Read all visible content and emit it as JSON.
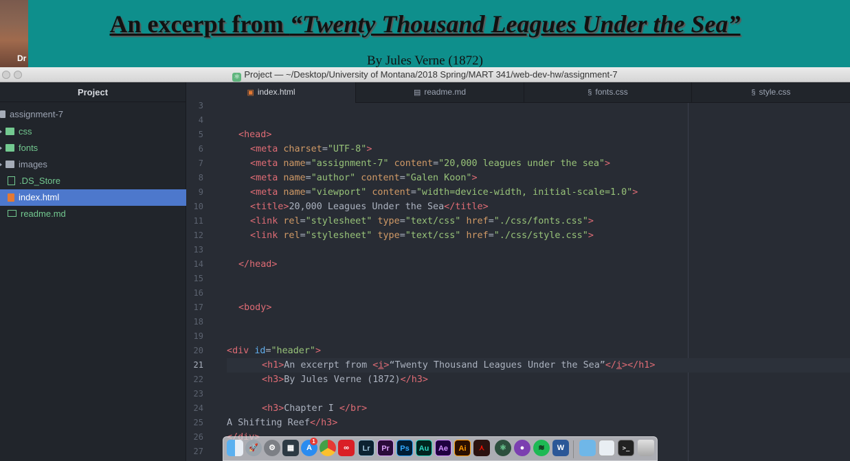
{
  "webpage": {
    "thumb_text": "Dr",
    "h1_prefix": "An excerpt from ",
    "h1_italic": "“Twenty Thousand Leagues Under the Sea”",
    "h3": "By Jules Verne (1872)"
  },
  "window": {
    "title": "Project — ~/Desktop/University of Montana/2018 Spring/MART 341/web-dev-hw/assignment-7"
  },
  "sidebar": {
    "header": "Project",
    "root": "assignment-7",
    "items": [
      {
        "label": "css",
        "type": "folder"
      },
      {
        "label": "fonts",
        "type": "folder"
      },
      {
        "label": "images",
        "type": "folder"
      },
      {
        "label": ".DS_Store",
        "type": "file"
      },
      {
        "label": "index.html",
        "type": "file"
      },
      {
        "label": "readme.md",
        "type": "file"
      }
    ]
  },
  "tabs": [
    {
      "label": "index.html",
      "icon": "html5-icon"
    },
    {
      "label": "readme.md",
      "icon": "book-icon"
    },
    {
      "label": "fonts.css",
      "icon": "css3-icon"
    },
    {
      "label": "style.css",
      "icon": "css3-icon"
    }
  ],
  "editor": {
    "line_numbers": [
      "3",
      "4",
      "5",
      "6",
      "7",
      "8",
      "9",
      "10",
      "11",
      "12",
      "13",
      "14",
      "15",
      "16",
      "17",
      "18",
      "19",
      "20",
      "21",
      "22",
      "23",
      "24",
      "25",
      "26",
      "27"
    ],
    "current_line": "21",
    "code": {
      "l5_open": "<",
      "l5_tag": "head",
      "l5_close": ">",
      "l6_tag": "meta",
      "l6_attr": "charset",
      "l6_val": "\"UTF-8\"",
      "l7_tag": "meta",
      "l7_attr1": "name",
      "l7_val1": "\"assignment-7\"",
      "l7_attr2": "content",
      "l7_val2": "\"20,000 leagues under the sea\"",
      "l8_tag": "meta",
      "l8_attr1": "name",
      "l8_val1": "\"author\"",
      "l8_attr2": "content",
      "l8_val2": "\"Galen Koon\"",
      "l9_tag": "meta",
      "l9_attr1": "name",
      "l9_val1": "\"viewport\"",
      "l9_attr2": "content",
      "l9_val2": "\"width=device-width, initial-scale=1.0\"",
      "l10_tag": "title",
      "l10_text": "20,000 Leagues Under the Sea",
      "l11_tag": "link",
      "l11_a1": "rel",
      "l11_v1": "\"stylesheet\"",
      "l11_a2": "type",
      "l11_v2": "\"text/css\"",
      "l11_a3": "href",
      "l11_v3": "\"./css/fonts.css\"",
      "l12_tag": "link",
      "l12_a1": "rel",
      "l12_v1": "\"stylesheet\"",
      "l12_a2": "type",
      "l12_v2": "\"text/css\"",
      "l12_a3": "href",
      "l12_v3": "\"./css/style.css\"",
      "l14_tag": "head",
      "l17_tag": "body",
      "l20_tag": "div",
      "l20_attr": "id",
      "l20_val": "\"header\"",
      "l21_tag": "h1",
      "l21_text1": "An excerpt from ",
      "l21_itag": "i",
      "l21_text2": "“Twenty Thousand Leagues Under the Sea”",
      "l22_tag": "h3",
      "l22_text": "By Jules Verne (1872)",
      "l24_tag": "h3",
      "l24_text": "Chapter I ",
      "l24_br": "br",
      "l25_text": "A Shifting Reef",
      "l26_tag": "div"
    }
  },
  "dock": {
    "apps": [
      "finder-icon",
      "launchpad-icon",
      "system-preferences-icon",
      "dashboard-icon",
      "app-store-icon",
      "chrome-icon",
      "creative-cloud-icon",
      "Lr",
      "Pr",
      "Ps",
      "Au",
      "Ae",
      "Ai",
      "acrobat-icon",
      "atom-icon",
      "github-icon",
      "spotify-icon",
      "word-icon",
      "downloads-folder-icon",
      "preview-icon",
      "terminal-icon",
      "trash-icon"
    ],
    "labels": {
      "lr": "Lr",
      "pr": "Pr",
      "ps": "Ps",
      "au": "Au",
      "ae": "Ae",
      "ai": "Ai"
    },
    "badge": "1"
  },
  "colors": {
    "page_bg": "#0e8f8c",
    "editor_bg": "#282c34",
    "sidebar_bg": "#21252b",
    "selection": "#4d78cc",
    "tag": "#e06c75",
    "attr": "#d19a66",
    "string": "#98c379"
  }
}
